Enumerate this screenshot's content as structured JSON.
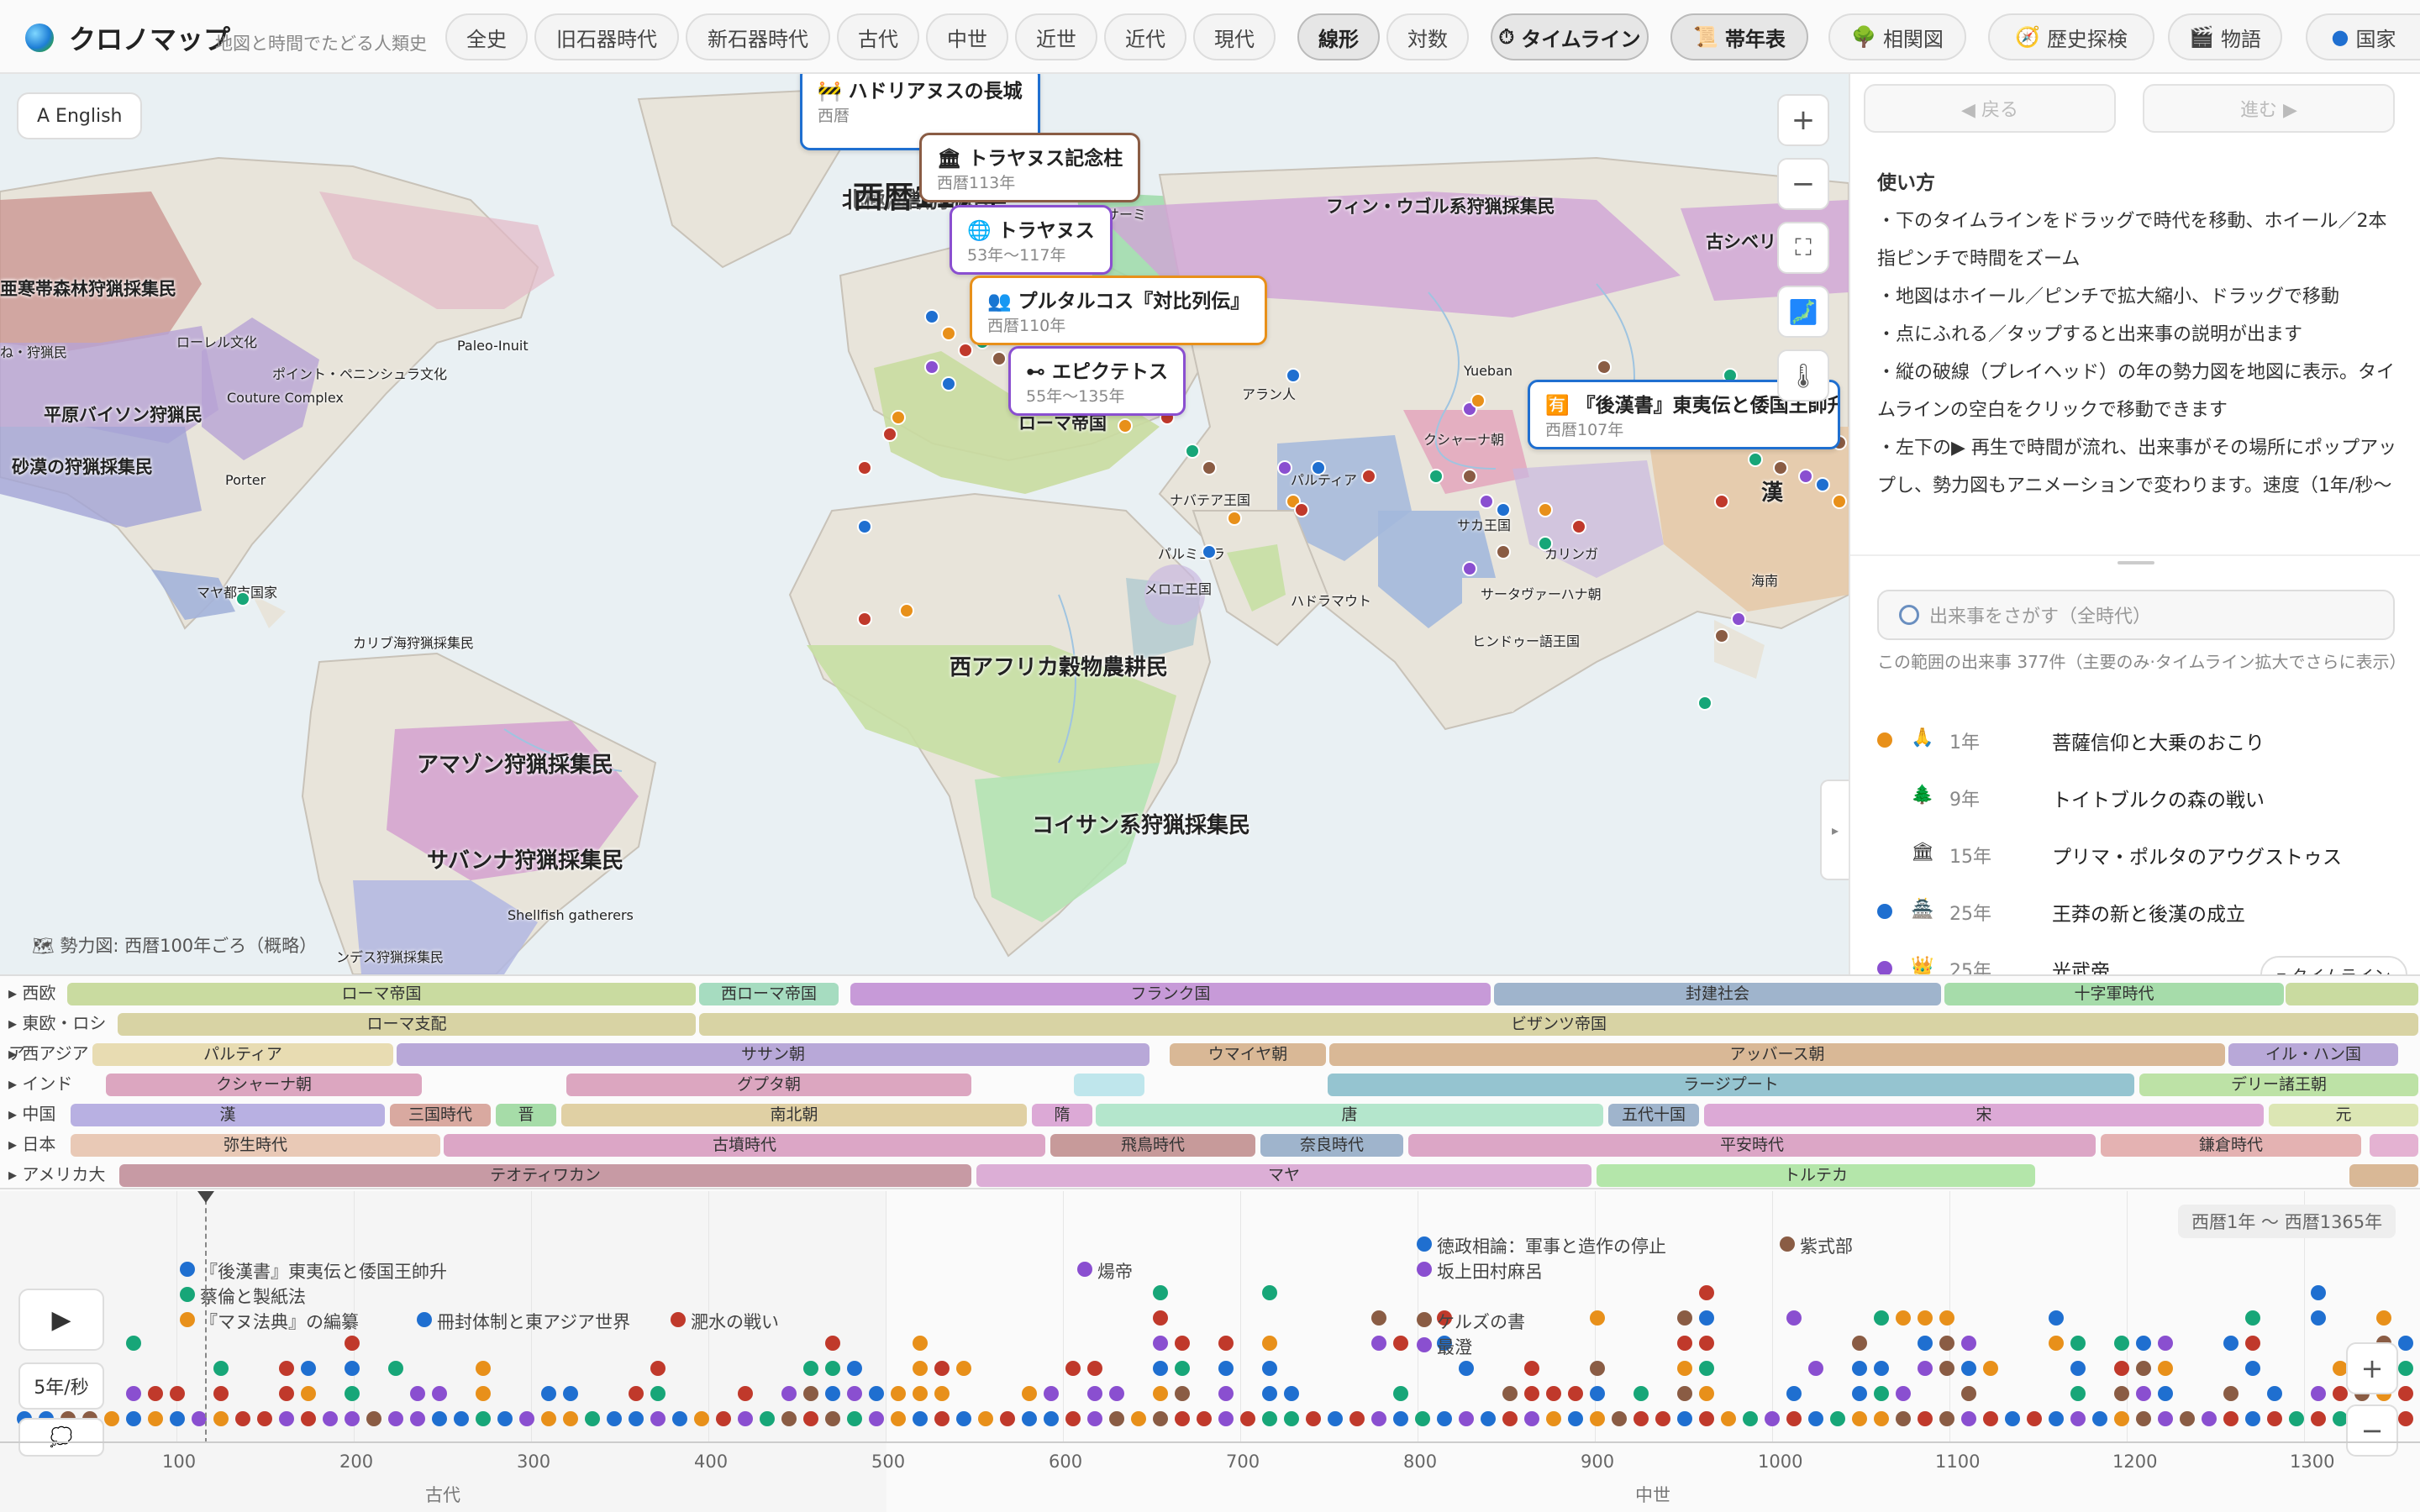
{
  "header": {
    "title": "クロノマップ",
    "subtitle": "地図と時間でたどる人類史",
    "periods": [
      "全史",
      "旧石器時代",
      "新石器時代",
      "古代",
      "中世",
      "近世",
      "近代",
      "現代"
    ],
    "scales": [
      "線形",
      "対数"
    ],
    "modes": [
      {
        "icon": "⏱",
        "label": "タイムライン"
      },
      {
        "icon": "📜",
        "label": "帯年表"
      },
      {
        "icon": "🌳",
        "label": "相関図"
      },
      {
        "icon": "🧭",
        "label": "歴史探検"
      },
      {
        "icon": "🎬",
        "label": "物語"
      },
      {
        "icon": "●",
        "label": "国家"
      }
    ]
  },
  "map": {
    "lang_button": "A English",
    "big_year": "西暦117年",
    "legend_note": "🗺 勢力図: 西暦100年ごろ（概略）",
    "controls": [
      "+",
      "−",
      "⛶",
      "🗾",
      "🌡"
    ],
    "cards": [
      {
        "icon": "🚧",
        "title": "ハドリアヌスの長城",
        "date": "西暦"
      },
      {
        "icon": "🏛",
        "title": "トラヤヌス記念柱",
        "date": "西暦113年"
      },
      {
        "icon": "🌐",
        "title": "トラヤヌス",
        "date": "53年〜117年"
      },
      {
        "icon": "👥",
        "title": "プルタルコス『対比列伝』",
        "date": "西暦110年"
      },
      {
        "icon": "⊷",
        "title": "エピクテトス",
        "date": "55年〜135年"
      },
      {
        "icon": "🈶",
        "title": "『後漢書』東夷伝と倭国王帥升",
        "date": "西暦107年"
      }
    ],
    "regions": [
      {
        "name": "北極海獣狩猟民",
        "size": "l"
      },
      {
        "name": "フィン・ウゴル系狩猟採集民",
        "size": "l"
      },
      {
        "name": "古シベリア狩",
        "size": "l"
      },
      {
        "name": "亜寒帯森林狩猟採集民",
        "size": "l"
      },
      {
        "name": "ローマ帝国",
        "size": "l"
      },
      {
        "name": "平原バイソン狩猟民",
        "size": "m"
      },
      {
        "name": "砂漠の狩猟採集民",
        "size": "m"
      },
      {
        "name": "西アフリカ穀物農耕民",
        "size": "l"
      },
      {
        "name": "アマゾン狩猟採集民",
        "size": "l"
      },
      {
        "name": "サバンナ狩猟採集民",
        "size": "l"
      },
      {
        "name": "コイサン系狩猟採集民",
        "size": "l"
      },
      {
        "name": "漢",
        "size": "l"
      },
      {
        "name": "パルティア",
        "size": "s"
      },
      {
        "name": "クシャーナ朝",
        "size": "s"
      },
      {
        "name": "サーミ",
        "size": "s"
      },
      {
        "name": "ローレル文化",
        "size": "s"
      },
      {
        "name": "ポイント・ペニンシュラ文化",
        "size": "s"
      },
      {
        "name": "Paleo-Inuit",
        "size": "s"
      },
      {
        "name": "Couture Complex",
        "size": "s"
      },
      {
        "name": "Porter",
        "size": "s"
      },
      {
        "name": "マヤ都市国家",
        "size": "s"
      },
      {
        "name": "カリブ海狩猟採集民",
        "size": "s"
      },
      {
        "name": "Shellfish gatherers",
        "size": "s"
      },
      {
        "name": "ンデス狩猟採集民",
        "size": "s"
      },
      {
        "name": "アラン人",
        "size": "s"
      },
      {
        "name": "Yueban",
        "size": "s"
      },
      {
        "name": "ナバテア王国",
        "size": "s"
      },
      {
        "name": "パルミュラ",
        "size": "s"
      },
      {
        "name": "メロエ王国",
        "size": "s"
      },
      {
        "name": "ハドラマウト",
        "size": "s"
      },
      {
        "name": "サカ王国",
        "size": "s"
      },
      {
        "name": "カリンガ",
        "size": "s"
      },
      {
        "name": "サータヴァーハナ朝",
        "size": "s"
      },
      {
        "name": "ヒンドゥー語王国",
        "size": "s"
      },
      {
        "name": "海南",
        "size": "s"
      },
      {
        "name": "ね・狩猟民",
        "size": "s"
      }
    ]
  },
  "sidebar": {
    "back": "◀ 戻る",
    "forward": "進む ▶",
    "howto_title": "使い方",
    "howto": [
      "・下のタイムラインをドラッグで時代を移動、ホイール／2本指ピンチで時間をズーム",
      "・地図はホイール／ピンチで拡大縮小、ドラッグで移動",
      "・点にふれる／タップすると出来事の説明が出ます",
      "・縦の破線（プレイヘッド）の年の勢力図を地図に表示。タイムラインの空白をクリックで移動できます",
      "・左下の▶ 再生で時間が流れ、出来事がその場所にポップアップし、勢力図もアニメーションで変わります。速度（1年/秒〜250年/秒）は▶の下のボタンで、ポップアップのオン／オフは"
    ],
    "search_placeholder": "出来事をさがす（全時代）",
    "count_text": "この範囲の出来事 377件（主要のみ·タイムライン拡大でさらに表示）",
    "events": [
      {
        "color": "#e8901a",
        "icon": "🙏",
        "year": "1年",
        "name": "菩薩信仰と大乗のおこり"
      },
      {
        "color": "",
        "icon": "🌲",
        "year": "9年",
        "name": "トイトブルクの森の戦い"
      },
      {
        "color": "",
        "icon": "🏛",
        "year": "15年",
        "name": "プリマ・ポルタのアウグストゥス"
      },
      {
        "color": "#1f6fd0",
        "icon": "🏯",
        "year": "25年",
        "name": "王莽の新と後漢の成立"
      },
      {
        "color": "#8a4fd0",
        "icon": "👑",
        "year": "25年",
        "name": "光武帝"
      }
    ],
    "timeline_toggle": "▾ タイムライン"
  },
  "bands": [
    {
      "region": "西欧",
      "items": [
        [
          "ローマ帝国",
          80,
          830,
          "#c9dba0"
        ],
        [
          "西ローマ帝国",
          832,
          1000,
          "#a6dcc0"
        ],
        [
          "フランク国",
          1012,
          1776,
          "#c79ad8"
        ],
        [
          "封建社会",
          1778,
          2312,
          "#9fb4cc"
        ],
        [
          "十字軍時代",
          2314,
          2720,
          "#a6dcaa"
        ],
        [
          "",
          2720,
          2880,
          "#c9dba0"
        ]
      ]
    },
    {
      "region": "東欧・ロシア",
      "items": [
        [
          "ローマ支配",
          140,
          830,
          "#d8d3a4"
        ],
        [
          "ビザンツ帝国",
          832,
          2880,
          "#d8d3a4"
        ]
      ]
    },
    {
      "region": "西アジア",
      "items": [
        [
          "パルティア",
          110,
          470,
          "#e8dcb2"
        ],
        [
          "ササン朝",
          472,
          1370,
          "#b8a8d8"
        ],
        [
          "ウマイヤ朝",
          1392,
          1580,
          "#d9b896"
        ],
        [
          "アッバース朝",
          1582,
          2650,
          "#d9b896"
        ],
        [
          "イル・ハン国",
          2652,
          2856,
          "#b8a8d8"
        ]
      ]
    },
    {
      "region": "インド",
      "items": [
        [
          "クシャーナ朝",
          126,
          504,
          "#dca6c0"
        ],
        [
          "グプタ朝",
          674,
          1158,
          "#dca6c0"
        ],
        [
          "",
          1278,
          1364,
          "#bfe6ec"
        ],
        [
          "ラージプート",
          1580,
          2542,
          "#95c4d0"
        ],
        [
          "デリー諸王朝",
          2546,
          2880,
          "#bde2a6"
        ]
      ]
    },
    {
      "region": "中国",
      "items": [
        [
          "漢",
          84,
          460,
          "#b8b0e2"
        ],
        [
          "三国時代",
          464,
          586,
          "#d9a9a0"
        ],
        [
          "晋",
          590,
          664,
          "#a6dca8"
        ],
        [
          "南北朝",
          668,
          1224,
          "#e0d0a4"
        ],
        [
          "隋",
          1228,
          1302,
          "#dca9d6"
        ],
        [
          "唐",
          1304,
          1910,
          "#b4e6cc"
        ],
        [
          "五代十国",
          1914,
          2024,
          "#9fb4cc"
        ],
        [
          "宋",
          2028,
          2696,
          "#dca9d6"
        ],
        [
          "元",
          2700,
          2880,
          "#dce6b4"
        ]
      ]
    },
    {
      "region": "日本",
      "items": [
        [
          "弥生時代",
          84,
          526,
          "#e9c9b6"
        ],
        [
          "古墳時代",
          528,
          1246,
          "#dca6c6"
        ],
        [
          "飛鳥時代",
          1250,
          1496,
          "#c79a9a"
        ],
        [
          "奈良時代",
          1500,
          1672,
          "#9fb4cc"
        ],
        [
          "平安時代",
          1676,
          2496,
          "#dca6c6"
        ],
        [
          "鎌倉時代",
          2500,
          2812,
          "#e4b2b2"
        ],
        [
          "",
          2820,
          2880,
          "#e4b2d2"
        ]
      ]
    },
    {
      "region": "アメリカ大陸",
      "items": [
        [
          "テオティワカン",
          142,
          1158,
          "#c79aa4"
        ],
        [
          "マヤ",
          1162,
          1896,
          "#dcaed6"
        ],
        [
          "トルテカ",
          1900,
          2424,
          "#b4e6aa"
        ],
        [
          "",
          2796,
          2880,
          "#d9b896"
        ]
      ]
    }
  ],
  "timeline": {
    "play": "▶",
    "speed": "5年/秒",
    "popup": "💭",
    "range": "西暦1年 〜 西暦1365年",
    "ticks": [
      "100",
      "200",
      "300",
      "400",
      "500",
      "600",
      "700",
      "800",
      "900",
      "1000",
      "1100",
      "1200",
      "1300"
    ],
    "eras": [
      "古代",
      "中世"
    ],
    "labels": [
      {
        "text": "『後漢書』東夷伝と倭国王帥升",
        "color": "#1f6fd0"
      },
      {
        "text": "蔡倫と製紙法",
        "color": "#17a678"
      },
      {
        "text": "『マヌ法典』の編纂",
        "color": "#e8901a"
      },
      {
        "text": "冊封体制と東アジア世界",
        "color": "#1f6fd0"
      },
      {
        "text": "淝水の戦い",
        "color": "#c0392b"
      },
      {
        "text": "煬帝",
        "color": "#8a4fd0"
      },
      {
        "text": "徳政相論：軍事と造作の停止",
        "color": "#1f6fd0"
      },
      {
        "text": "坂上田村麻呂",
        "color": "#8a4fd0"
      },
      {
        "text": "ケルズの書",
        "color": "#8a5c44"
      },
      {
        "text": "最澄",
        "color": "#8a4fd0"
      },
      {
        "text": "紫式部",
        "color": "#8a5c44"
      }
    ],
    "zoom_in": "+",
    "zoom_out": "−"
  },
  "colors": {
    "accent": "#8a4fd0",
    "blue": "#1f6fd0",
    "orange": "#e8901a",
    "red": "#c0392b",
    "green": "#17a678",
    "brown": "#8a5c44",
    "purple": "#8a4fd0"
  }
}
